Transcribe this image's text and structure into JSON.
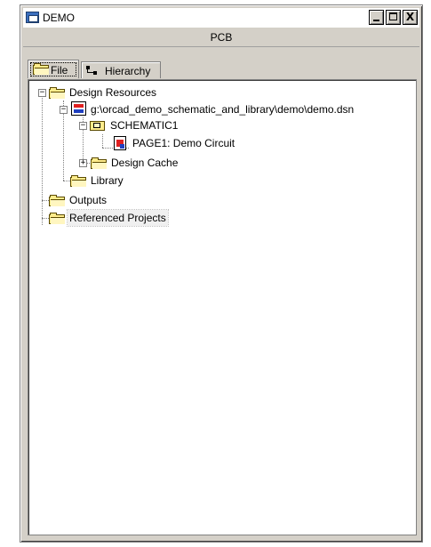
{
  "window": {
    "title": "DEMO",
    "controls": {
      "minimize": "_",
      "maximize": "□",
      "close": "X"
    }
  },
  "toolbar": {
    "label": "PCB"
  },
  "tabs": [
    {
      "label": "File",
      "icon": "folder-icon",
      "active": true
    },
    {
      "label": "Hierarchy",
      "icon": "hierarchy-icon",
      "active": false
    }
  ],
  "tree": {
    "design_resources": "Design Resources",
    "dsn_path": "g:\\orcad_demo_schematic_and_library\\demo\\demo.dsn",
    "schematic": "SCHEMATIC1",
    "page": "PAGE1: Demo Circuit",
    "design_cache": "Design Cache",
    "library": "Library",
    "outputs": "Outputs",
    "referenced_projects": "Referenced Projects"
  },
  "colors": {
    "frame": "#d4d0c8",
    "folder": "#ffec8c",
    "icon_red": "#e02020",
    "icon_blue": "#2040c0"
  }
}
